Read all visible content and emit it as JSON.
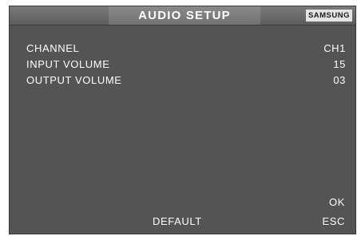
{
  "header": {
    "title": "AUDIO SETUP",
    "brand": "SAMSUNG"
  },
  "settings": [
    {
      "label": "CHANNEL",
      "value": "CH1"
    },
    {
      "label": "INPUT VOLUME",
      "value": "15"
    },
    {
      "label": "OUTPUT VOLUME",
      "value": "03"
    }
  ],
  "buttons": {
    "ok": "OK",
    "default": "DEFAULT",
    "esc": "ESC"
  }
}
